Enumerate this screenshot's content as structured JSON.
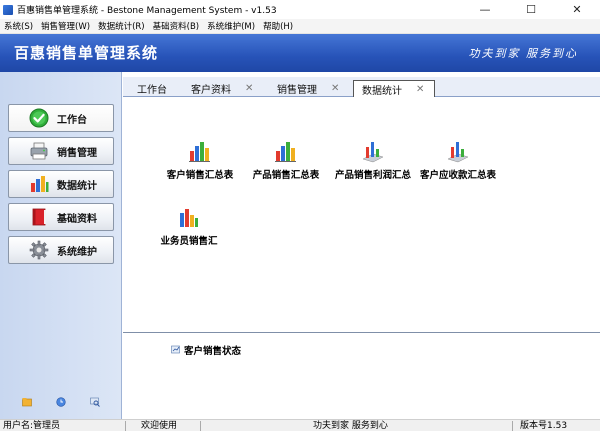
{
  "window": {
    "title": "百惠销售单管理系统 - Bestone Management System - v1.53",
    "controls": [
      "—",
      "☐",
      "✕"
    ]
  },
  "menu": [
    "系统(S)",
    "销售管理(W)",
    "数据统计(R)",
    "基础资料(B)",
    "系统维护(M)",
    "帮助(H)"
  ],
  "banner": {
    "title": "百惠销售单管理系统",
    "slogan": "功夫到家 服务到心"
  },
  "nav": [
    {
      "label": "工作台",
      "icon": "check-circle-icon",
      "active": true
    },
    {
      "label": "销售管理",
      "icon": "printer-icon",
      "active": false
    },
    {
      "label": "数据统计",
      "icon": "bar-chart-icon",
      "active": false
    },
    {
      "label": "基础资料",
      "icon": "book-icon",
      "active": false
    },
    {
      "label": "系统维护",
      "icon": "gear-icon",
      "active": false
    }
  ],
  "tabs": [
    {
      "label": "工作台",
      "closable": false,
      "active": false
    },
    {
      "label": "客户资料",
      "closable": true,
      "active": false
    },
    {
      "label": "销售管理",
      "closable": true,
      "active": false
    },
    {
      "label": "数据统计",
      "closable": true,
      "active": true
    }
  ],
  "stats": [
    {
      "label": "客户销售汇总表",
      "icon": "bar-chart-icon"
    },
    {
      "label": "产品销售汇总表",
      "icon": "bar-chart-icon"
    },
    {
      "label": "产品销售利润汇总",
      "icon": "3d-chart-icon"
    },
    {
      "label": "客户应收款汇总表",
      "icon": "3d-chart-icon"
    },
    {
      "label": "业务员销售汇",
      "icon": "bar-chart-icon"
    }
  ],
  "status_panel": {
    "heading": "客户销售状态"
  },
  "statusbar": {
    "user": "用户名:管理员",
    "welcome": "欢迎使用",
    "slogan": "功夫到家 服务到心",
    "version": "版本号1.53"
  },
  "colors": {
    "banner": "#2753b8",
    "nav_bg": "#d2def3",
    "tab_bg": "#e9eef8"
  }
}
